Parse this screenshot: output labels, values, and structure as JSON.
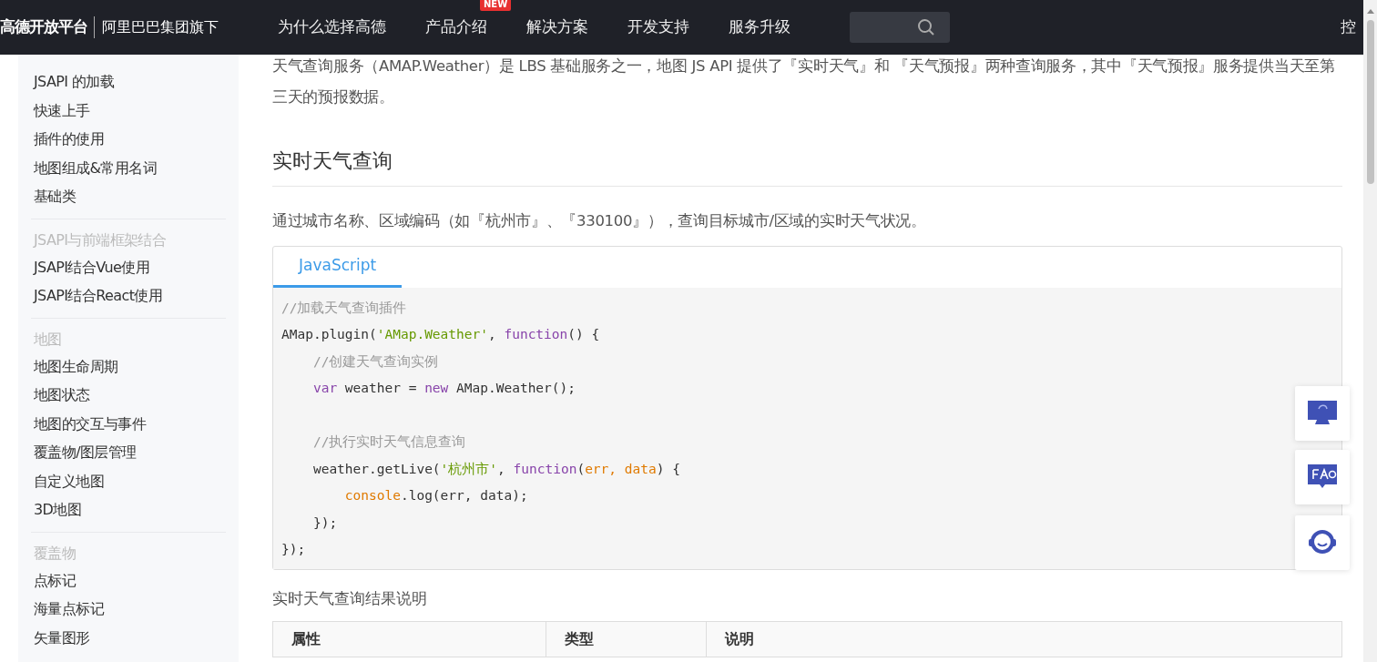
{
  "header": {
    "logo": "高德开放平台",
    "logo_sub": "阿里巴巴集团旗下",
    "nav": [
      {
        "label": "为什么选择高德"
      },
      {
        "label": "产品介绍",
        "badge": "NEW"
      },
      {
        "label": "解决方案"
      },
      {
        "label": "开发支持"
      },
      {
        "label": "服务升级"
      }
    ],
    "console_link": "控"
  },
  "sidebar": {
    "groups": [
      {
        "items": [
          "JSAPI 的加载",
          "快速上手",
          "插件的使用",
          "地图组成&常用名词",
          "基础类"
        ]
      },
      {
        "title": "JSAPI与前端框架结合",
        "items": [
          "JSAPI结合Vue使用",
          "JSAPI结合React使用"
        ]
      },
      {
        "title": "地图",
        "items": [
          "地图生命周期",
          "地图状态",
          "地图的交互与事件",
          "覆盖物/图层管理",
          "自定义地图",
          "3D地图"
        ]
      },
      {
        "title": "覆盖物",
        "items": [
          "点标记",
          "海量点标记",
          "矢量图形"
        ]
      }
    ]
  },
  "content": {
    "intro": "天气查询服务（AMAP.Weather）是 LBS 基础服务之一，地图 JS API 提供了『实时天气』和 『天气预报』两种查询服务，其中『天气预报』服务提供当天至第三天的预报数据。",
    "heading": "实时天气查询",
    "description": "通过城市名称、区域编码（如『杭州市』、『330100』），查询目标城市/区域的实时天气状况。",
    "code_tabs": [
      {
        "label": "JavaScript",
        "selected": true
      }
    ],
    "code_lines": [
      {
        "kind": "code",
        "tokens": [
          {
            "text": "//加载天气查询插件",
            "kind": "comment"
          }
        ]
      },
      {
        "kind": "code",
        "tokens": [
          {
            "text": "AMap.plugin(",
            "kind": "plain"
          },
          {
            "text": "'AMap.Weather'",
            "kind": "string"
          },
          {
            "text": ", ",
            "kind": "plain"
          },
          {
            "text": "function",
            "kind": "keyword"
          },
          {
            "text": "() {",
            "kind": "plain"
          }
        ]
      },
      {
        "kind": "code",
        "tokens": [
          {
            "text": "    //创建天气查询实例",
            "kind": "comment"
          }
        ]
      },
      {
        "kind": "code",
        "tokens": [
          {
            "text": "    var",
            "kind": "keyword"
          },
          {
            "text": " weather = ",
            "kind": "plain"
          },
          {
            "text": "new",
            "kind": "keyword"
          },
          {
            "text": " AMap.Weather();",
            "kind": "plain"
          }
        ]
      },
      {
        "kind": "blank"
      },
      {
        "kind": "code",
        "tokens": [
          {
            "text": "    //执行实时天气信息查询",
            "kind": "comment"
          }
        ]
      },
      {
        "kind": "code",
        "tokens": [
          {
            "text": "    weather.getLive(",
            "kind": "plain"
          },
          {
            "text": "'杭州市'",
            "kind": "string"
          },
          {
            "text": ", ",
            "kind": "plain"
          },
          {
            "text": "function",
            "kind": "keyword"
          },
          {
            "text": "(",
            "kind": "plain"
          },
          {
            "text": "err, data",
            "kind": "param"
          },
          {
            "text": ") {",
            "kind": "plain"
          }
        ]
      },
      {
        "kind": "code",
        "tokens": [
          {
            "text": "        console",
            "kind": "param"
          },
          {
            "text": ".log(err, data);",
            "kind": "plain"
          }
        ]
      },
      {
        "kind": "code",
        "tokens": [
          {
            "text": "    });",
            "kind": "plain"
          }
        ]
      },
      {
        "kind": "code",
        "tokens": [
          {
            "text": "});",
            "kind": "plain"
          }
        ]
      }
    ],
    "table_caption": "实时天气查询结果说明",
    "table": {
      "columns": [
        "属性",
        "类型",
        "说明"
      ]
    }
  }
}
